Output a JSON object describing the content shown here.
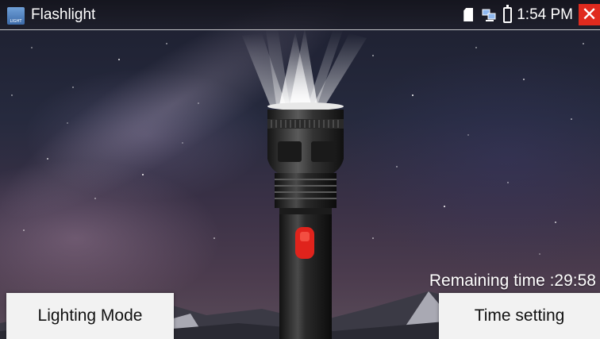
{
  "titlebar": {
    "app_icon_label": "LIGHT",
    "title": "Flashlight",
    "time": "1:54 PM",
    "close_symbol": "✕",
    "icons": [
      "app-icon",
      "sd-card-icon",
      "network-icon",
      "battery-icon",
      "close-icon"
    ]
  },
  "flashlight": {
    "remaining_label": "Remaining time :29:58",
    "power_button_color": "#e0231c"
  },
  "buttons": {
    "lighting_mode": "Lighting Mode",
    "time_setting": "Time setting"
  },
  "colors": {
    "close_bg": "#e02a1e",
    "button_bg": "#f2f2f2",
    "title_text": "#ffffff"
  }
}
